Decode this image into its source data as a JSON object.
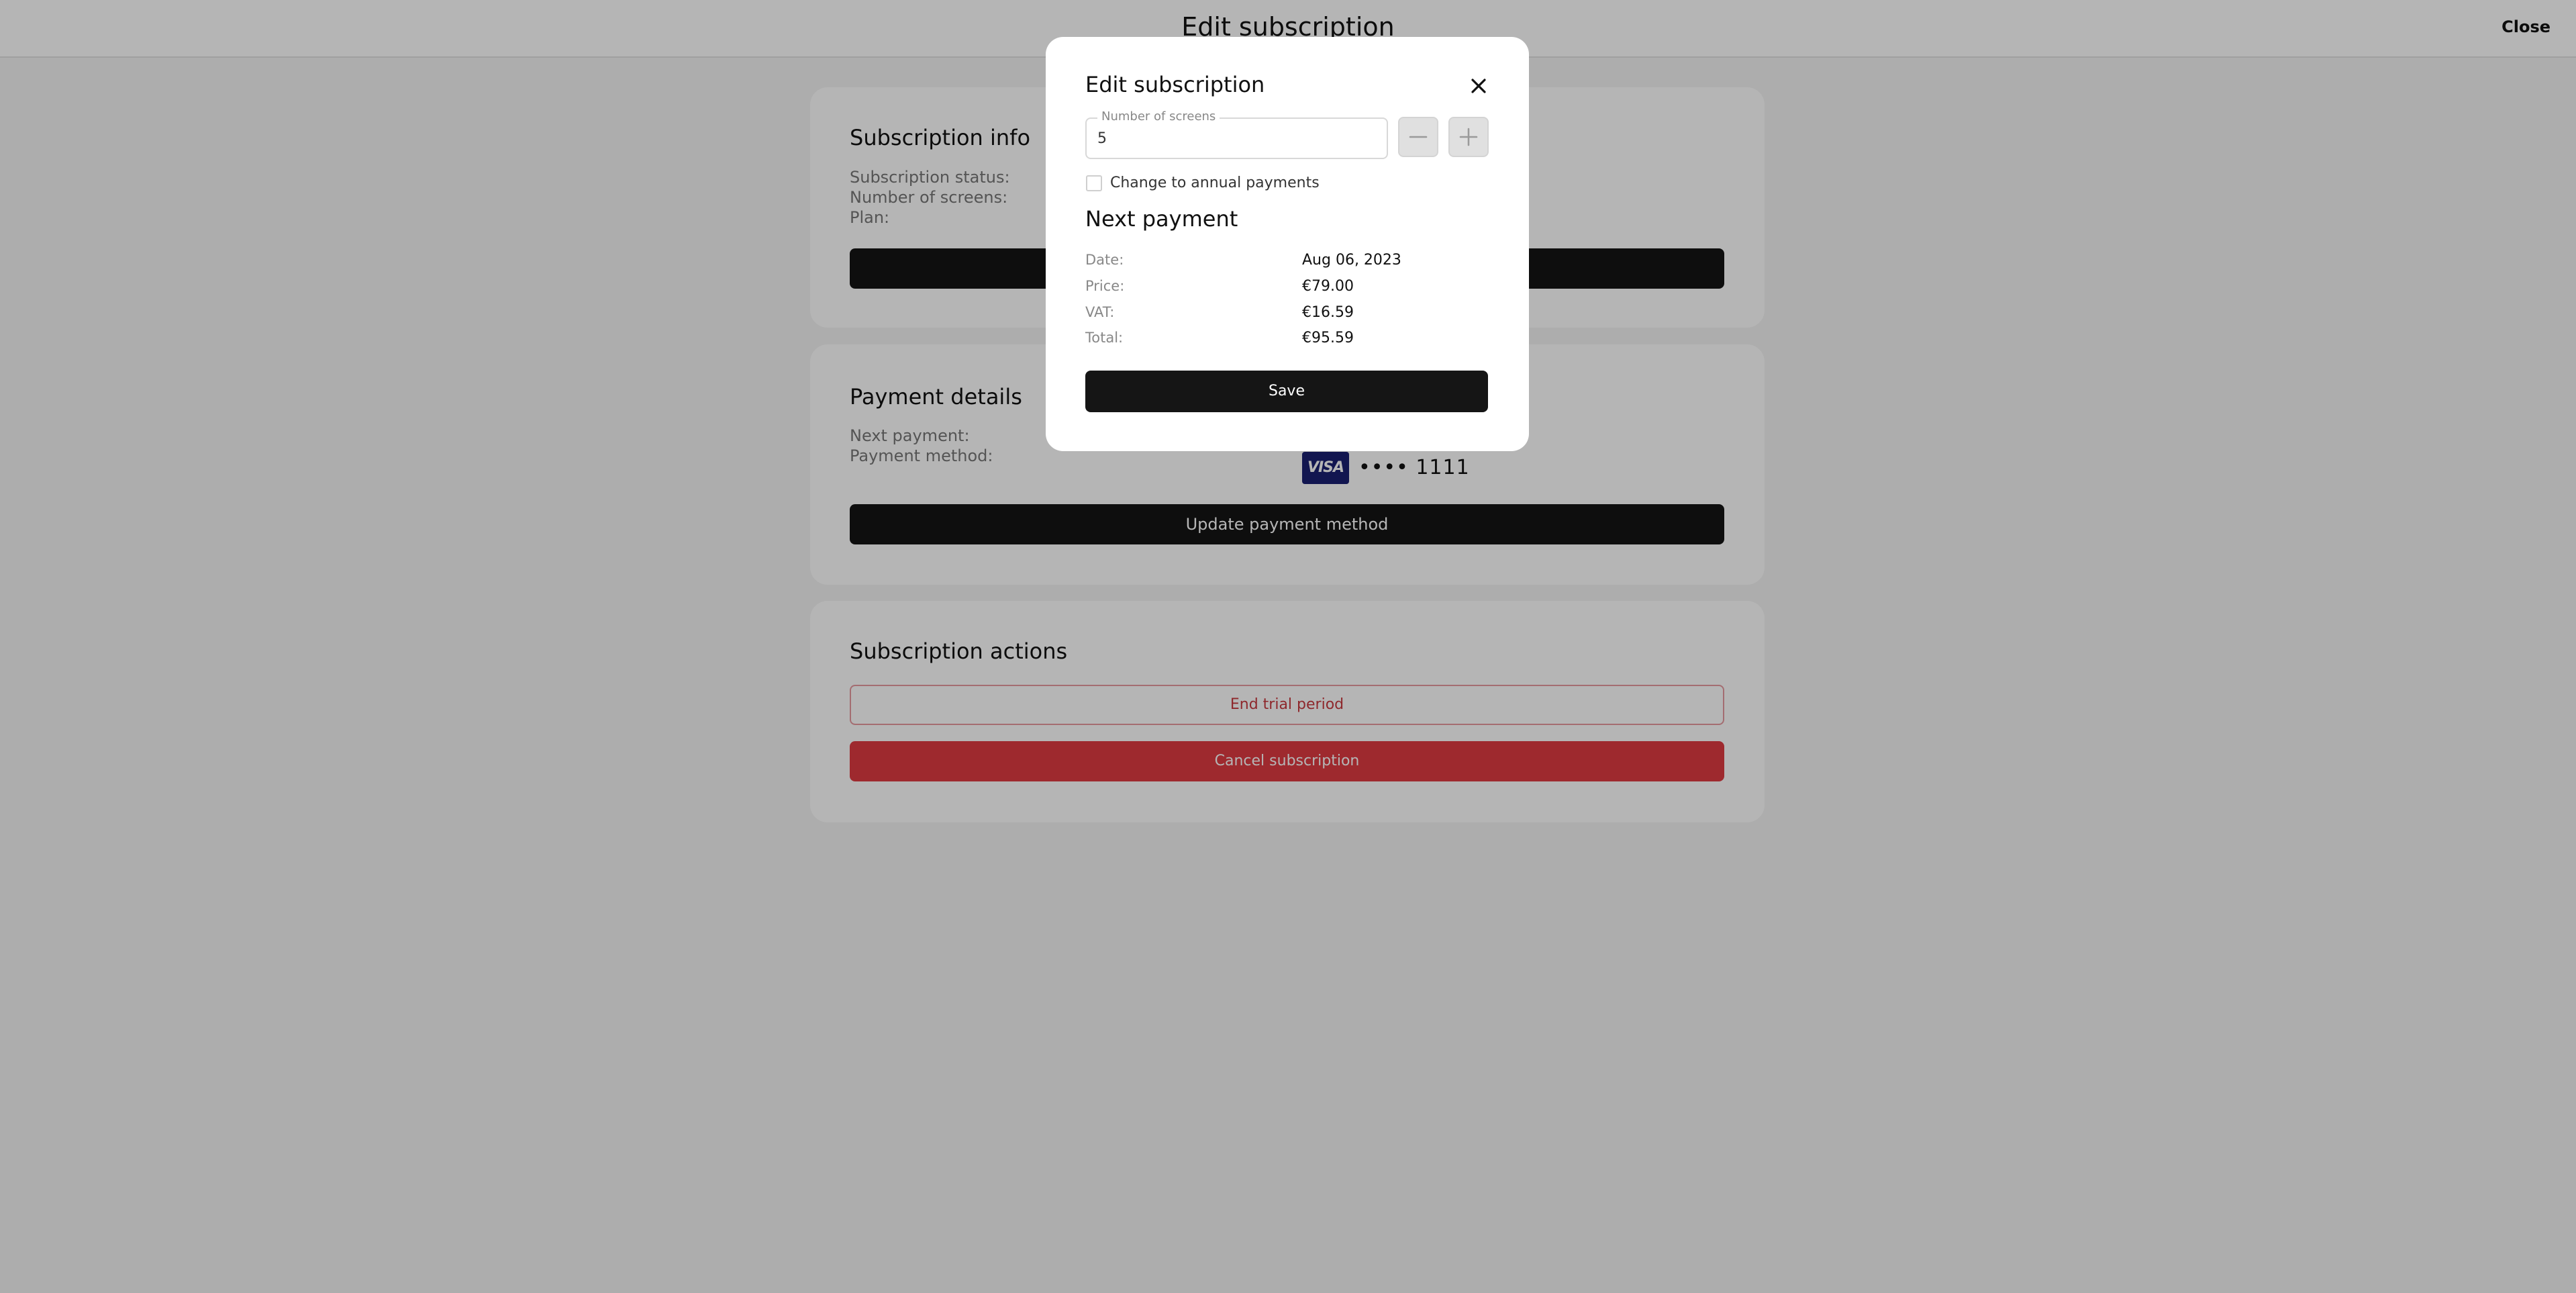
{
  "topbar": {
    "title": "Edit subscription",
    "close_label": "Close"
  },
  "subscription_info": {
    "title": "Subscription info",
    "status_label": "Subscription status:",
    "screens_label": "Number of screens:",
    "plan_label": "Plan:"
  },
  "payment_details": {
    "title": "Payment details",
    "next_payment_label": "Next payment:",
    "method_label": "Payment method:",
    "card_brand": "VISA",
    "card_masked": "•••• 1111",
    "update_button": "Update payment method"
  },
  "subscription_actions": {
    "title": "Subscription actions",
    "end_trial_button": "End trial period",
    "cancel_button": "Cancel subscription"
  },
  "modal": {
    "title": "Edit subscription",
    "screens_field": {
      "label": "Number of screens",
      "value": "5"
    },
    "annual_checkbox": {
      "label": "Change to annual payments",
      "checked": false
    },
    "next_payment": {
      "title": "Next payment",
      "rows": [
        {
          "label": "Date:",
          "value": "Aug 06, 2023"
        },
        {
          "label": "Price:",
          "value": "€79.00"
        },
        {
          "label": "VAT:",
          "value": "€16.59"
        },
        {
          "label": "Total:",
          "value": "€95.59"
        }
      ]
    },
    "save_button": "Save"
  },
  "colors": {
    "dark_button": "#151515",
    "danger": "#df3a42",
    "visa_blue": "#1a1f71",
    "overlay": "rgba(0,0,0,0.29)"
  },
  "icons": {
    "modal_close": "close-icon",
    "decrement": "minus-icon",
    "increment": "plus-icon"
  }
}
